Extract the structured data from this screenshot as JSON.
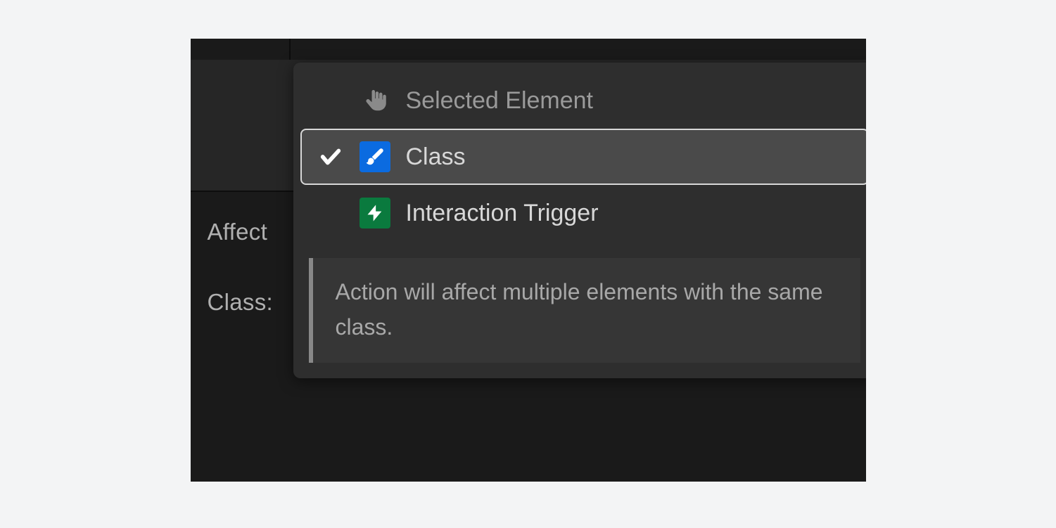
{
  "panel": {
    "labels": {
      "affect": "Affect",
      "class": "Class:"
    }
  },
  "dropdown": {
    "items": [
      {
        "label": "Selected Element",
        "icon": "pointer",
        "selected": false
      },
      {
        "label": "Class",
        "icon": "paintbrush",
        "selected": true
      },
      {
        "label": "Interaction Trigger",
        "icon": "bolt",
        "selected": false
      }
    ],
    "hint": "Action will affect multiple elements with the same class."
  }
}
